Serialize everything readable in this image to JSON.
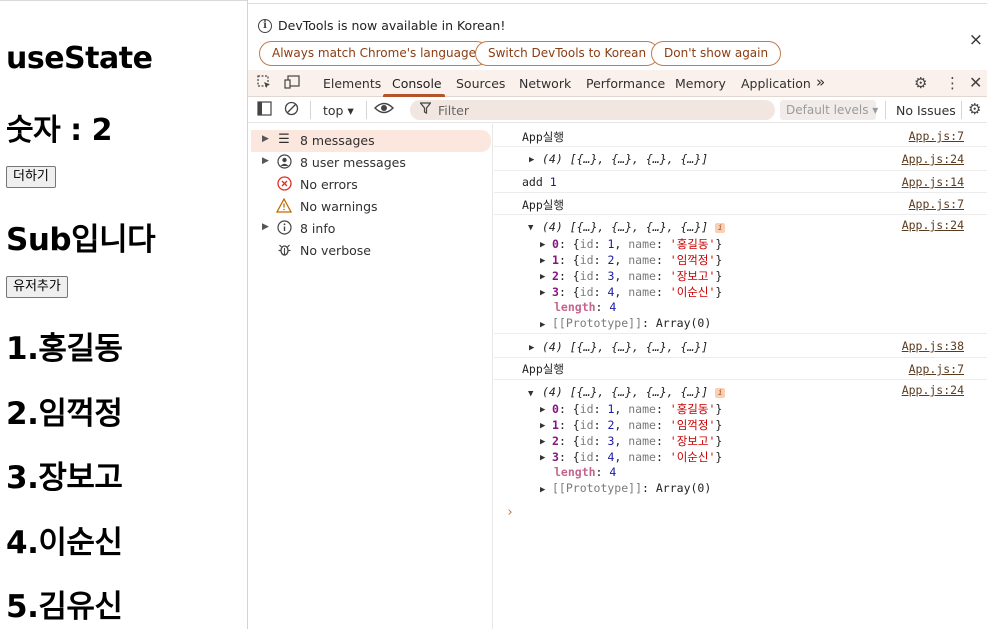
{
  "page": {
    "heading": "useState",
    "count_text": "숫자 : 2",
    "add_button": "더하기",
    "sub_heading": "Sub입니다",
    "add_user_button": "유저추가",
    "users": [
      "1.홍길동",
      "2.임꺽정",
      "3.장보고",
      "4.이순신",
      "5.김유신"
    ]
  },
  "devtools": {
    "infobar": {
      "message": "DevTools is now available in Korean!",
      "btn_match": "Always match Chrome's language",
      "btn_switch": "Switch DevTools to Korean",
      "btn_dont_show": "Don't show again",
      "close": "×"
    },
    "tabs": [
      "Elements",
      "Console",
      "Sources",
      "Network",
      "Performance",
      "Memory",
      "Application"
    ],
    "more_tabs": "»",
    "toolbar": {
      "context": "top ▾",
      "filter_placeholder": "Filter",
      "levels": "Default levels ▾",
      "issues": "No Issues"
    },
    "sidebar": [
      {
        "label": "8 messages",
        "icon": "list-icon"
      },
      {
        "label": "8 user messages",
        "icon": "user-icon"
      },
      {
        "label": "No errors",
        "icon": "error-icon"
      },
      {
        "label": "No warnings",
        "icon": "warning-icon"
      },
      {
        "label": "8 info",
        "icon": "info-icon"
      },
      {
        "label": "No verbose",
        "icon": "bug-icon"
      }
    ],
    "console": {
      "log1": "App실행",
      "src_app7": "App.js:7",
      "src_app24": "App.js:24",
      "src_app14": "App.js:14",
      "src_app38": "App.js:38",
      "array_summary": "(4) [{…}, {…}, {…}, {…}]",
      "add_text": "add",
      "add_value": "1",
      "items": [
        {
          "idx": "0",
          "id": "1",
          "name": "'홍길동'"
        },
        {
          "idx": "1",
          "id": "2",
          "name": "'임꺽정'"
        },
        {
          "idx": "2",
          "id": "3",
          "name": "'장보고'"
        },
        {
          "idx": "3",
          "id": "4",
          "name": "'이순신'"
        }
      ],
      "length_key": "length",
      "length_val": "4",
      "prototype": "[[Prototype]]",
      "prototype_val": "Array(0)"
    }
  }
}
